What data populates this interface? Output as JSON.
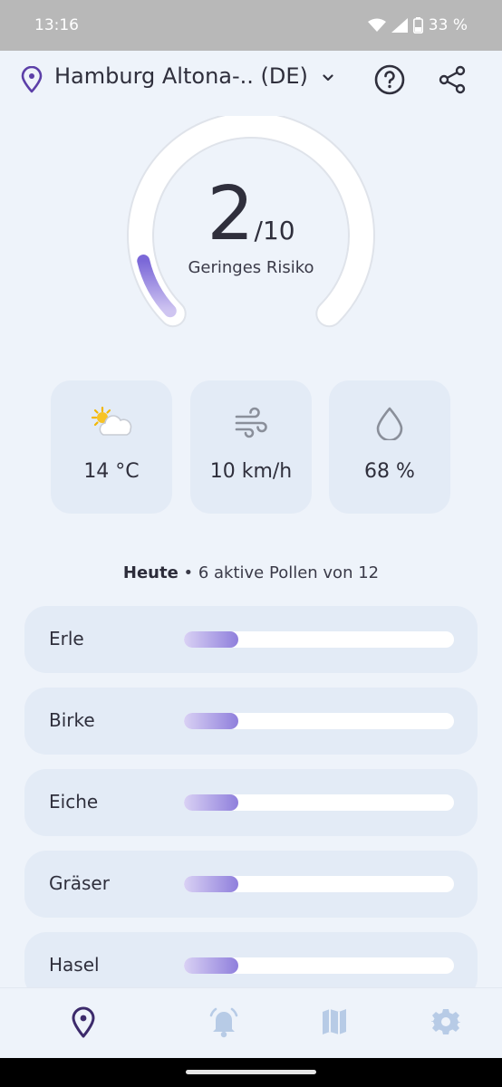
{
  "status": {
    "time": "13:16",
    "battery": "33 %"
  },
  "header": {
    "location": "Hamburg Altona-.. (DE)",
    "icons": [
      "location-pin-icon",
      "chevron-down-icon",
      "help-icon",
      "share-icon"
    ]
  },
  "risk": {
    "value": "2",
    "denominator": "/10",
    "label": "Geringes Risiko",
    "fraction": 0.2
  },
  "weather": {
    "temperature": "14 °C",
    "wind": "10 km/h",
    "humidity": "68 %"
  },
  "today": {
    "bold": "Heute",
    "rest": " • 6 aktive Pollen von 12"
  },
  "pollen": [
    {
      "name": "Erle",
      "level": 0.2
    },
    {
      "name": "Birke",
      "level": 0.2
    },
    {
      "name": "Eiche",
      "level": 0.2
    },
    {
      "name": "Gräser",
      "level": 0.2
    },
    {
      "name": "Hasel",
      "level": 0.2
    }
  ],
  "nav": [
    "location-icon",
    "bell-icon",
    "map-icon",
    "gear-icon"
  ],
  "colors": {
    "accent": "#5c3fa8",
    "gauge": "#8f7fdc",
    "inactive_nav": "#b7cbe6"
  }
}
